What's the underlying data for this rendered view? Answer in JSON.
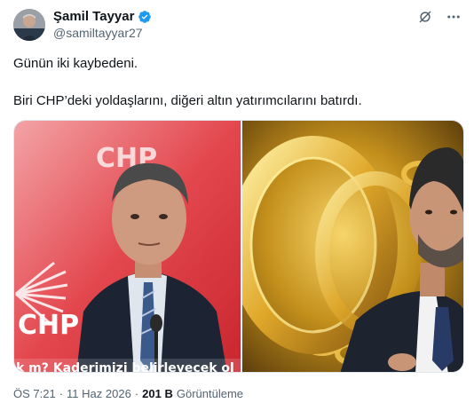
{
  "author": {
    "display_name": "Şamil Tayyar",
    "handle": "@samiltayyar27",
    "verified": true
  },
  "tweet": {
    "line1": "Günün iki kaybedeni.",
    "line2": "Biri CHP’deki yoldaşlarını, diğeri altın yatırımcılarını batırdı."
  },
  "media": {
    "left_logo_text": "CHP",
    "left_logo_text_2": "CHP",
    "left_caption": "k m? Kaderimizi belirleyecek ol"
  },
  "meta": {
    "time": "ÖS 7:21",
    "date": "11 Haz 2026",
    "views_count": "201 B",
    "views_label": "Görüntüleme",
    "separator": "·"
  },
  "icons": {
    "verified": "verified-badge-icon",
    "grok": "grok-icon",
    "more": "more-icon"
  },
  "colors": {
    "verified_blue": "#1d9bf0",
    "chp_red": "#d6262f",
    "gold": "#d4a017"
  }
}
